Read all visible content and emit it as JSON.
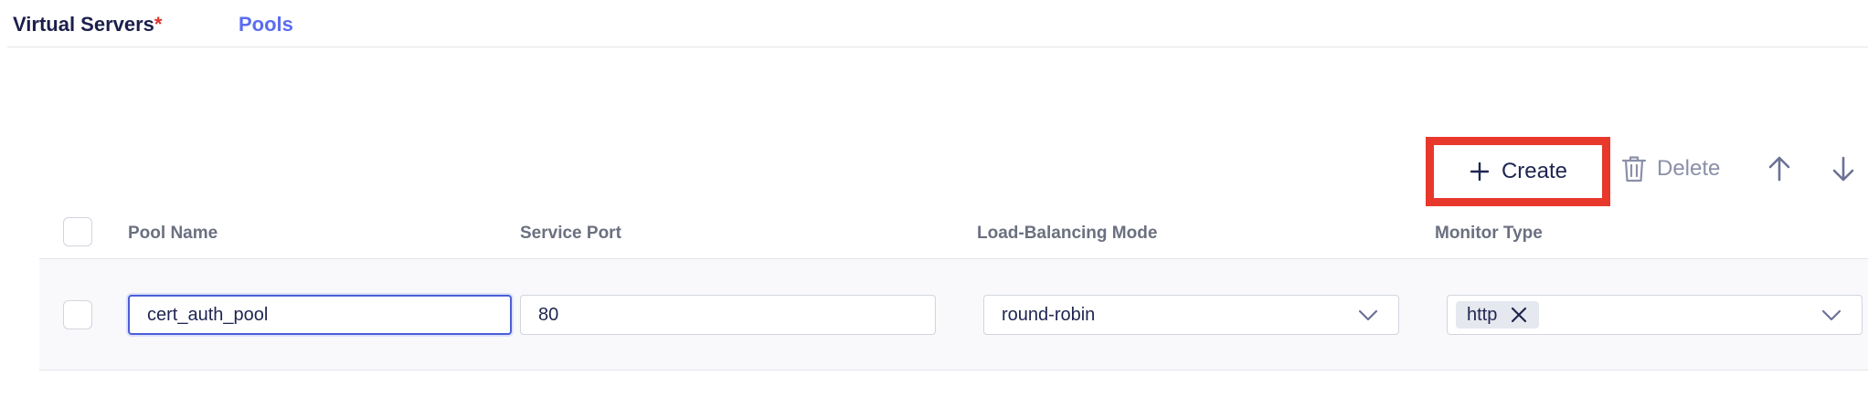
{
  "tabs": [
    {
      "label": "Virtual Servers",
      "required_mark": "*",
      "active": true
    },
    {
      "label": "Pools",
      "active": false
    }
  ],
  "toolbar": {
    "create_label": "Create",
    "delete_label": "Delete",
    "move_up_icon": "arrow-up-icon",
    "move_down_icon": "arrow-down-icon"
  },
  "table": {
    "columns": [
      "Pool Name",
      "Service Port",
      "Load-Balancing Mode",
      "Monitor Type"
    ],
    "rows": [
      {
        "pool_name": "cert_auth_pool",
        "service_port": "80",
        "lb_mode": "round-robin",
        "monitor_types": [
          "http"
        ]
      }
    ]
  },
  "colors": {
    "accent": "#5b6cf0",
    "required": "#e0312a",
    "highlight_box": "#e8382b",
    "focus_border": "#4b5fd6"
  }
}
